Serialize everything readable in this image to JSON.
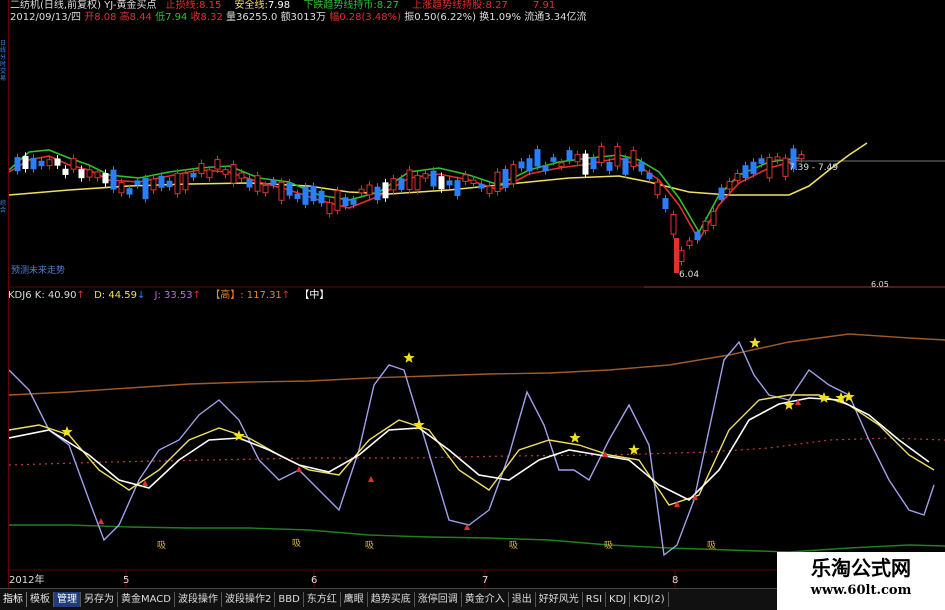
{
  "sidebar": {
    "vtext_top": "日线分时交易",
    "vtext_bottom": "综合"
  },
  "header1": {
    "stock": "二纺机(日线,前复权) YJ-黄金买点",
    "line1_label": "止损线:",
    "line1_value": "8.15",
    "safe_label": "安全线:",
    "safe_value": "7.98",
    "down_label": "下跌趋势线持币:",
    "down_value": "8.27",
    "up_label": "上涨趋势线持股:",
    "up_value": "8.27",
    "right_value": "7.91"
  },
  "header2": {
    "date": "2012/09/13/四",
    "open": "开8.08",
    "high": "高8.44",
    "low": "低7.94",
    "close": "收8.32",
    "volume": "量36255.0",
    "amount": "额3013万",
    "change": "幅0.28(3.48%)",
    "swing": "振0.50(6.22%)",
    "turnover": "换1.09%",
    "float": "流通3.34亿流"
  },
  "main_chart": {
    "chart_data": {
      "type": "candlestick",
      "annotations": [
        "预测未来走势",
        "6.04",
        "7.39 - 7.49",
        "6.05"
      ]
    }
  },
  "kdj": {
    "title": "KDJ6",
    "k": "K: 40.90",
    "k_arrow": "↑",
    "d": "D: 44.59",
    "d_arrow": "↓",
    "j": "J: 33.53",
    "j_arrow": "↑",
    "high_label": "【高】",
    "high_value": ": 117.31",
    "high_arrow": "↑",
    "mid_label": "【中】",
    "buy_signal": "吸"
  },
  "time_axis": {
    "year": "2012年",
    "months": [
      "5",
      "6",
      "7",
      "8"
    ]
  },
  "bottom_tabs": [
    {
      "label": "指标",
      "type": "label"
    },
    {
      "label": "模板",
      "type": "tab"
    },
    {
      "label": "管理",
      "type": "active"
    },
    {
      "label": "另存为",
      "type": "tab"
    },
    {
      "label": "黄金MACD",
      "type": "tab"
    },
    {
      "label": "波段操作",
      "type": "tab"
    },
    {
      "label": "波段操作2",
      "type": "tab"
    },
    {
      "label": "BBD",
      "type": "tab"
    },
    {
      "label": "东方红",
      "type": "tab"
    },
    {
      "label": "鹰眼",
      "type": "tab"
    },
    {
      "label": "趋势买底",
      "type": "tab"
    },
    {
      "label": "涨停回调",
      "type": "tab"
    },
    {
      "label": "黄金介入",
      "type": "tab"
    },
    {
      "label": "退出",
      "type": "tab"
    },
    {
      "label": "好好风光",
      "type": "tab"
    },
    {
      "label": "RSI",
      "type": "tab"
    },
    {
      "label": "KDJ",
      "type": "tab"
    },
    {
      "label": "KDJ(2)",
      "type": "tab"
    }
  ],
  "watermark": {
    "title": "乐淘公式网",
    "url": "www.60lt.com"
  },
  "colors": {
    "up": "#e03030",
    "down": "#2a7fff",
    "yellow": "#f0e060",
    "green": "#30c030",
    "white": "#ffffff",
    "purple": "#a0a0e8",
    "brown": "#a05a28",
    "darkgreen": "#208020"
  }
}
